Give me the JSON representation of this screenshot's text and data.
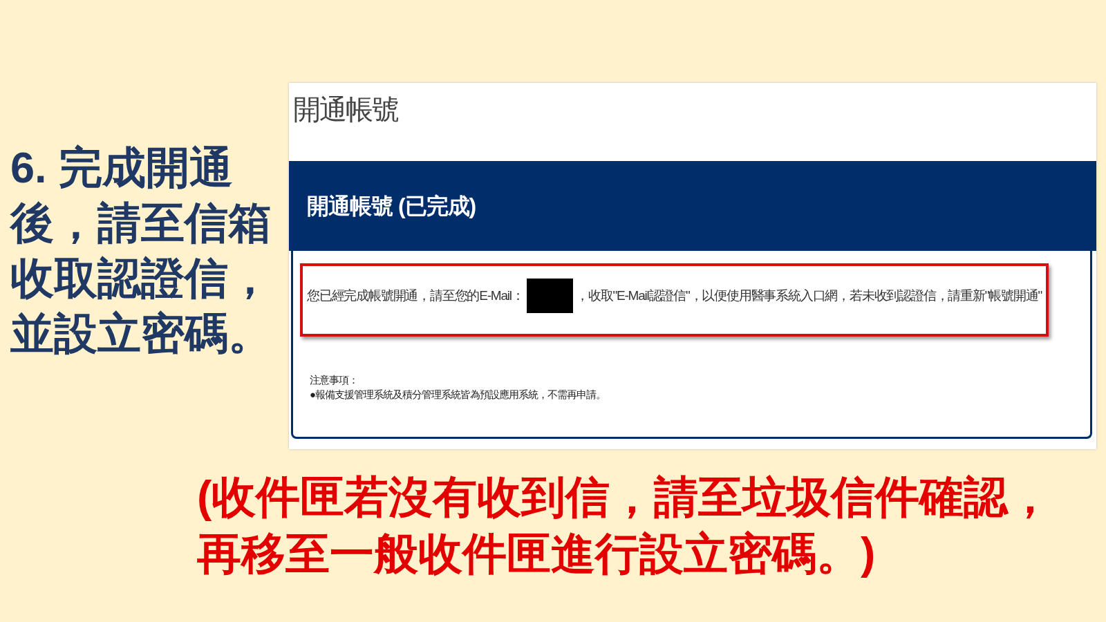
{
  "slide_heading": "6. 完成開通後，請至信箱收取認證信，並設立密碼。",
  "screenshot": {
    "page_title": "開通帳號",
    "banner_title": "開通帳號 (已完成)",
    "message_before": "您已經完成帳號開通，請至您的E-Mail：",
    "message_after": "，收取\"E-Mail認證信\"，以便使用醫事系統入口網，若未收到認證信，請重新\"帳號開通\"",
    "notes_title": "注意事項：",
    "notes": [
      "●報備支援管理系統及積分管理系統皆為預設應用系統，不需再申請。"
    ]
  },
  "footnote": "(收件匣若沒有收到信，請至垃圾信件確認，再移至一般收件匣進行設立密碼。)"
}
